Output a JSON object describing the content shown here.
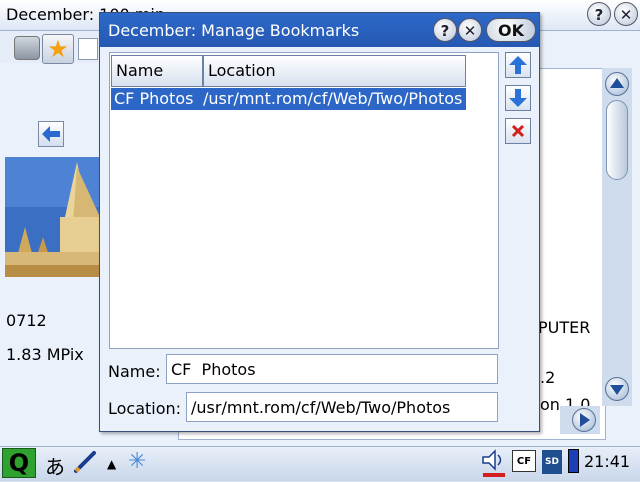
{
  "background_app": {
    "title": "December:  100 min...",
    "help_label": "?",
    "close_label": "✕",
    "toolbar": {
      "star_icon": "★"
    },
    "photo": {
      "id": "0712",
      "size": "1.83  MPix"
    },
    "details": [
      "PUTER",
      ".2",
      "on  1.0"
    ]
  },
  "dialog": {
    "title": "December:  Manage  Bookmarks",
    "help_label": "?",
    "close_label": "✕",
    "ok_label": "OK",
    "columns": {
      "name": "Name",
      "location": "Location"
    },
    "bookmarks": [
      {
        "name": "CF  Photos",
        "location": "/usr/mnt.rom/cf/Web/Two/Photos"
      }
    ],
    "form": {
      "name_label": "Name:",
      "name_value": "CF  Photos",
      "location_label": "Location:",
      "location_value": "/usr/mnt.rom/cf/Web/Two/Photos"
    },
    "icons": [
      "arrow-up-icon",
      "arrow-down-icon",
      "delete-icon"
    ]
  },
  "taskbar": {
    "q_label": "Q",
    "ime_label": "あ",
    "tray_up": "▲",
    "snow_icon": "✳",
    "cf_label": "CF",
    "sd_label": "SD",
    "clock": "21:41"
  },
  "colors": {
    "accent": "#2c66c6",
    "title_bar": "#2558b2",
    "window_bg": "#eaf1fb"
  }
}
